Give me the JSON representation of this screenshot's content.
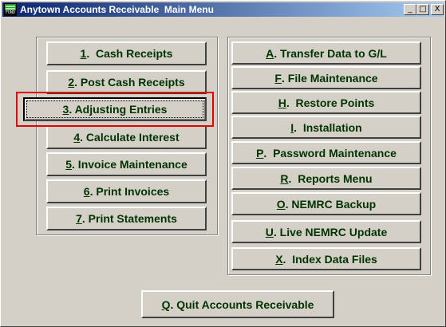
{
  "window": {
    "title": "Anytown Accounts Receivable  Main Menu",
    "icon_label": "FUND",
    "controls": {
      "minimize": "_",
      "maximize": "□",
      "close": "X"
    }
  },
  "left_menu": [
    {
      "key": "1",
      "rest": ".  Cash Receipts"
    },
    {
      "key": "2",
      "rest": ". Post Cash Receipts"
    },
    {
      "key": "3",
      "rest": ". Adjusting Entries"
    },
    {
      "key": "4",
      "rest": ". Calculate Interest"
    },
    {
      "key": "5",
      "rest": ". Invoice Maintenance"
    },
    {
      "key": "6",
      "rest": ". Print Invoices"
    },
    {
      "key": "7",
      "rest": ". Print Statements"
    }
  ],
  "right_menu": [
    {
      "key": "A",
      "rest": ". Transfer Data to G/L"
    },
    {
      "key": "F",
      "rest": ". File Maintenance"
    },
    {
      "key": "H",
      "rest": ".  Restore Points"
    },
    {
      "key": "I",
      "rest": ".  Installation"
    },
    {
      "key": "P",
      "rest": ".  Password Maintenance"
    },
    {
      "key": "R",
      "rest": ".  Reports Menu"
    },
    {
      "key": "O",
      "rest": ". NEMRC Backup"
    },
    {
      "key": "U",
      "rest": ". Live NEMRC Update"
    },
    {
      "key": "X",
      "rest": ".  Index Data Files"
    }
  ],
  "quit": {
    "key": "Q",
    "rest": ". Quit Accounts Receivable"
  },
  "colors": {
    "button_text": "#003300",
    "highlight": "#e00000",
    "titlebar": "#0a246a"
  }
}
